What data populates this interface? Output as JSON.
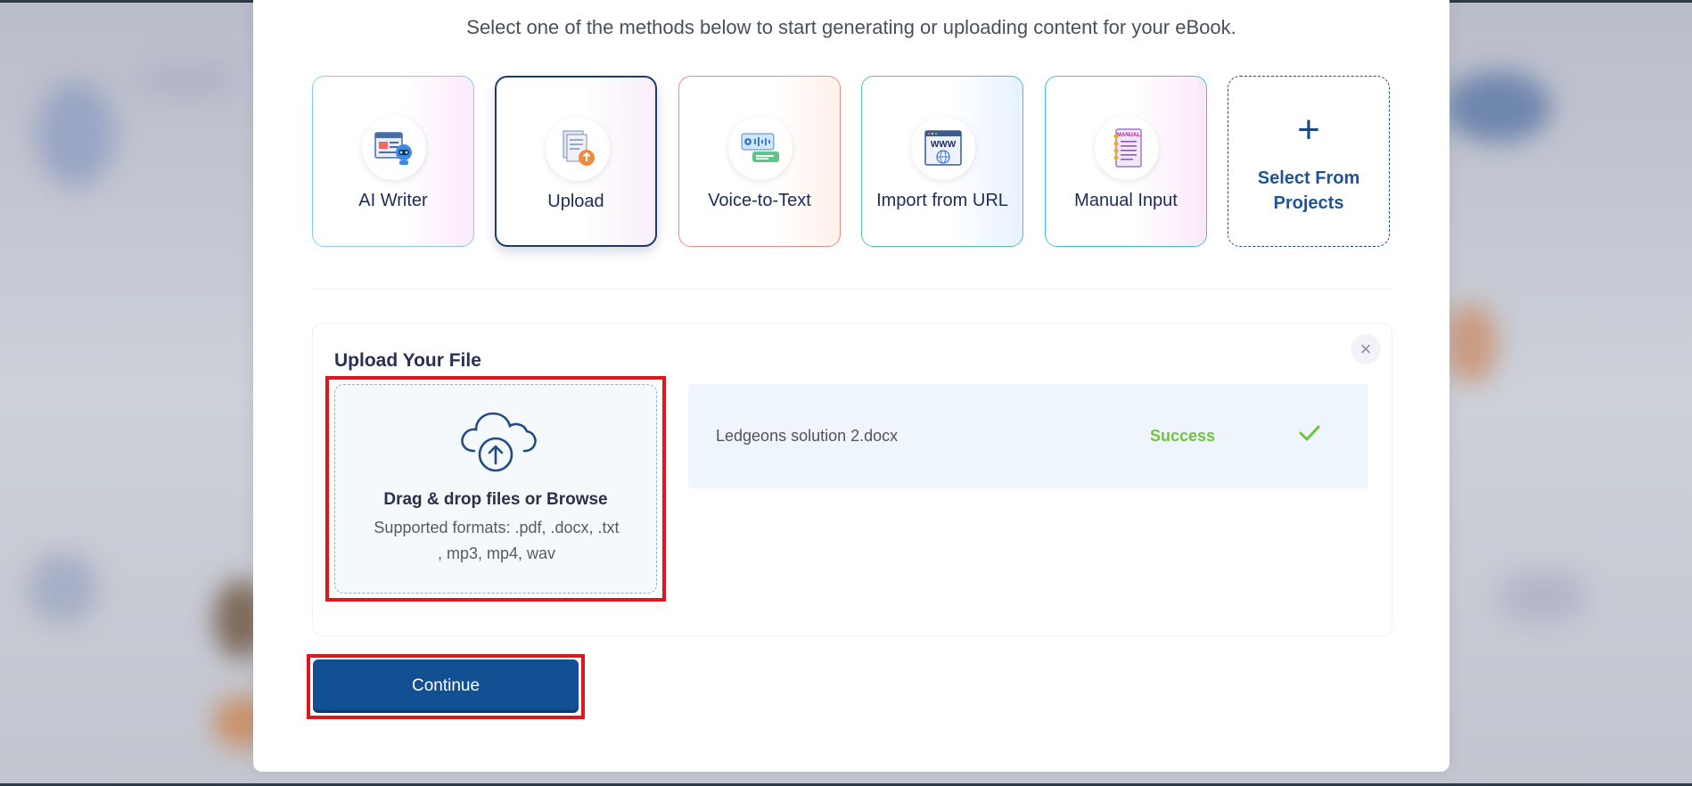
{
  "modal": {
    "subtitle": "Select one of the methods below to start generating or uploading content for your eBook."
  },
  "methods": [
    {
      "label": "AI Writer",
      "icon": "ai-writer-robot-icon"
    },
    {
      "label": "Upload",
      "icon": "upload-document-icon",
      "selected": true
    },
    {
      "label": "Voice-to-Text",
      "icon": "voice-to-text-icon"
    },
    {
      "label": "Import from URL",
      "icon": "www-globe-icon"
    },
    {
      "label": "Manual Input",
      "icon": "manual-notebook-icon",
      "icon_text": "MANUAL"
    },
    {
      "label": "Select From Projects",
      "icon": "plus-icon",
      "line1": "Select From",
      "line2": "Projects"
    }
  ],
  "upload_panel": {
    "title": "Upload Your File",
    "close_icon": "close-icon",
    "dropzone": {
      "title": "Drag & drop files or Browse",
      "formats_line1": "Supported formats: .pdf, .docx, .txt",
      "formats_line2": ", mp3, mp4, wav"
    },
    "files": [
      {
        "name": "Ledgeons solution 2.docx",
        "status": "Success"
      }
    ]
  },
  "actions": {
    "continue_label": "Continue"
  },
  "colors": {
    "primary": "#134f93",
    "success": "#6fc43a",
    "highlight": "#e0161e"
  }
}
